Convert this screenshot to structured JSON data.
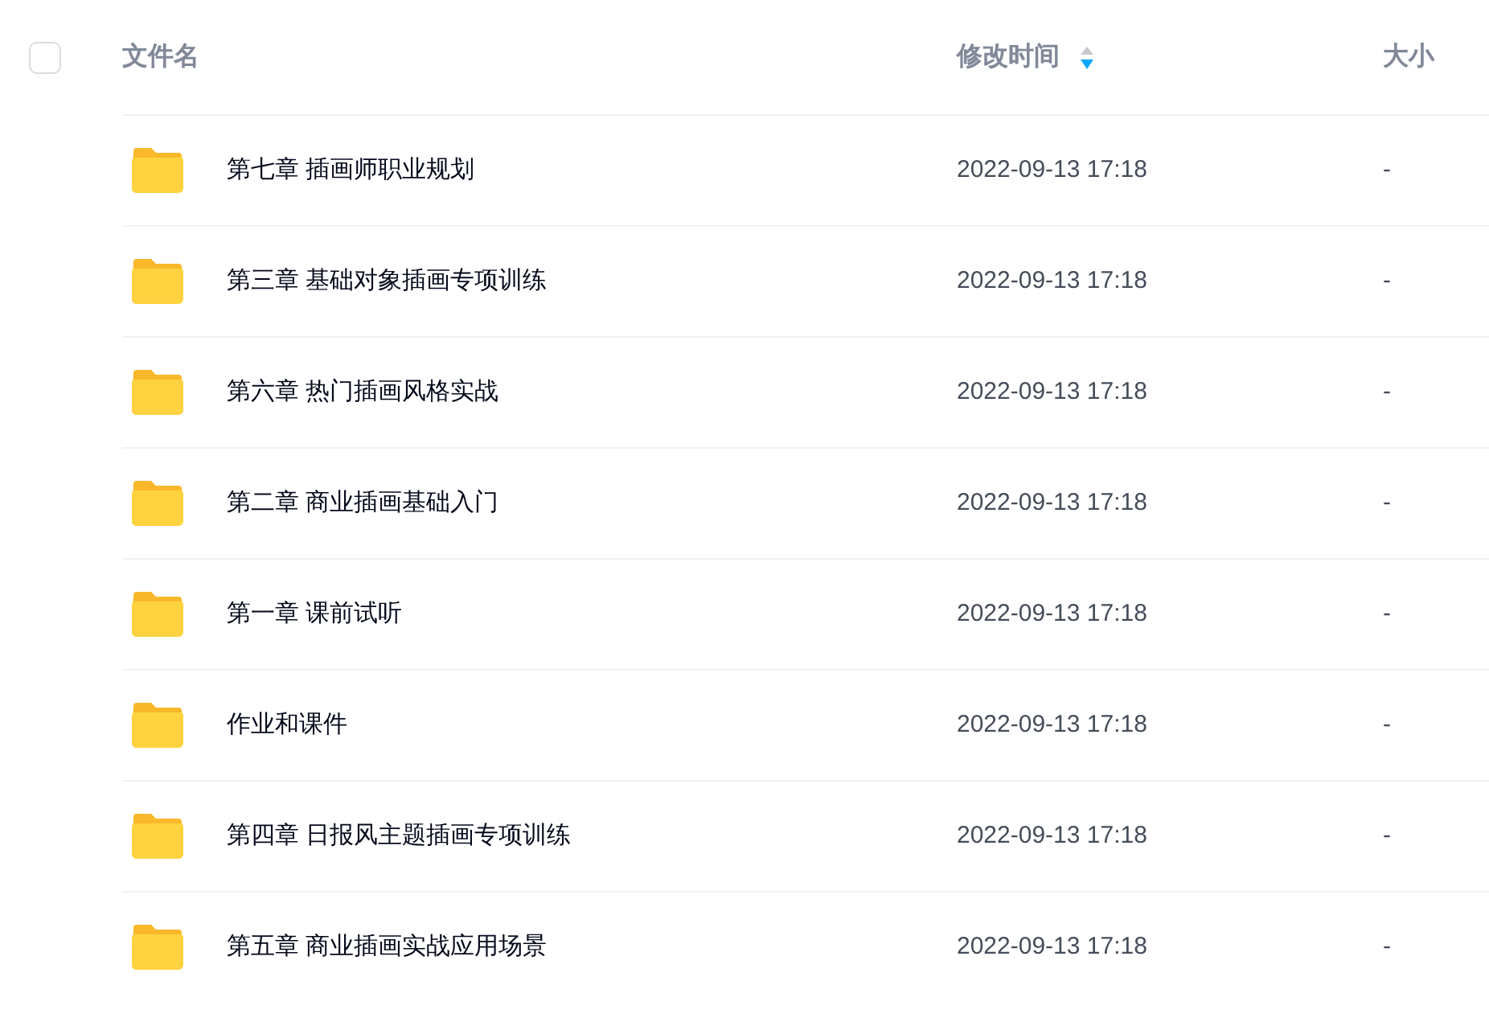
{
  "header": {
    "select_all": {
      "checked": false
    },
    "columns": [
      {
        "label": "文件名",
        "sorted": false
      },
      {
        "label": "修改时间",
        "sorted": true,
        "descending": true
      },
      {
        "label": "大小",
        "sorted": false
      }
    ]
  },
  "rows": [
    {
      "name": "第七章 插画师职业规划",
      "modified": "2022-09-13 17:18",
      "size": "-"
    },
    {
      "name": "第三章 基础对象插画专项训练",
      "modified": "2022-09-13 17:18",
      "size": "-"
    },
    {
      "name": "第六章 热门插画风格实战",
      "modified": "2022-09-13 17:18",
      "size": "-"
    },
    {
      "name": "第二章 商业插画基础入门",
      "modified": "2022-09-13 17:18",
      "size": "-"
    },
    {
      "name": "第一章 课前试听",
      "modified": "2022-09-13 17:18",
      "size": "-"
    },
    {
      "name": "作业和课件",
      "modified": "2022-09-13 17:18",
      "size": "-"
    },
    {
      "name": "第四章 日报风主题插画专项训练",
      "modified": "2022-09-13 17:18",
      "size": "-"
    },
    {
      "name": "第五章 商业插画实战应用场景",
      "modified": "2022-09-13 17:18",
      "size": "-"
    }
  ]
}
